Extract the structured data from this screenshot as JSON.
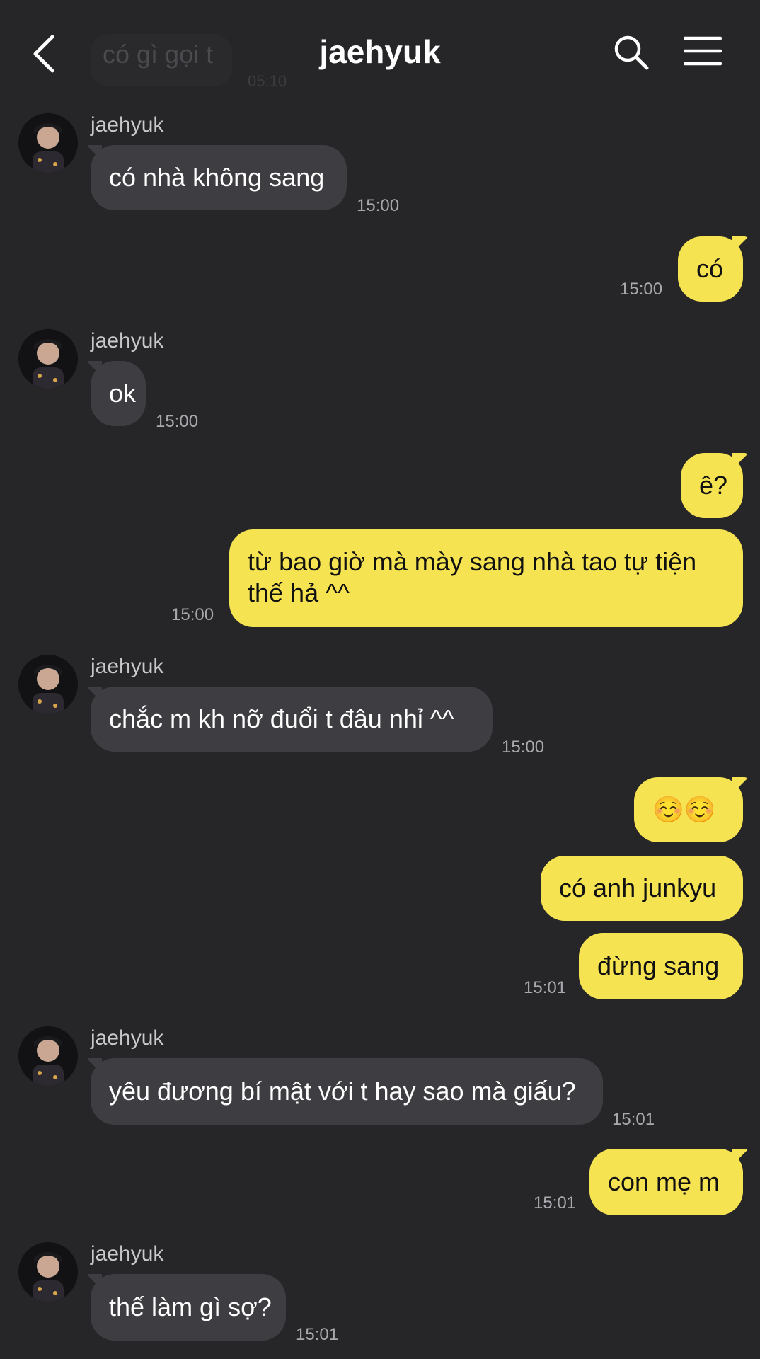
{
  "header": {
    "title": "jaehyuk",
    "ghost_text": "có gì gọi t",
    "ghost_time": "05:10"
  },
  "messages": [
    {
      "from": "jaehyuk",
      "sender": "jaehyuk",
      "text": "có nhà không sang",
      "time": "15:00"
    },
    {
      "from": "me",
      "text": "có",
      "time": "15:00"
    },
    {
      "from": "jaehyuk",
      "sender": "jaehyuk",
      "text": "ok",
      "time": "15:00"
    },
    {
      "from": "me",
      "text": "ê?",
      "time": ""
    },
    {
      "from": "me",
      "text": "từ bao giờ mà mày sang nhà tao tự tiện thế hả ^^",
      "time": "15:00"
    },
    {
      "from": "jaehyuk",
      "sender": "jaehyuk",
      "text": "chắc m kh nỡ đuổi t đâu nhỉ ^^",
      "time": "15:00"
    },
    {
      "from": "me",
      "text": "☺️☺️",
      "time": ""
    },
    {
      "from": "me",
      "text": "có anh junkyu",
      "time": ""
    },
    {
      "from": "me",
      "text": "đừng sang",
      "time": "15:01"
    },
    {
      "from": "jaehyuk",
      "sender": "jaehyuk",
      "text": "yêu đương bí mật với t hay sao mà giấu?",
      "time": "15:01"
    },
    {
      "from": "me",
      "text": "con mẹ m",
      "time": "15:01"
    },
    {
      "from": "jaehyuk",
      "sender": "jaehyuk",
      "text": "thế làm gì sợ?",
      "time": "15:01"
    }
  ],
  "colors": {
    "background": "#262629",
    "incoming": "#3d3d42",
    "outgoing": "#f6e352"
  },
  "icons": {
    "back": "chevron-left-icon",
    "search": "search-icon",
    "menu": "hamburger-menu-icon"
  }
}
